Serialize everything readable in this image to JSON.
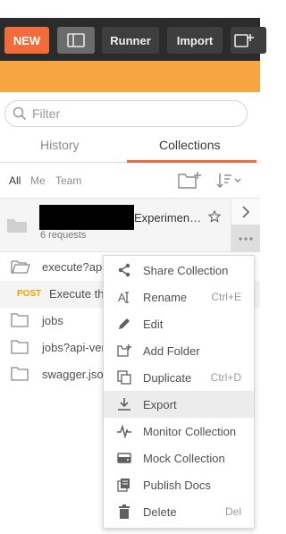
{
  "toolbar": {
    "new_label": "NEW",
    "runner_label": "Runner",
    "import_label": "Import"
  },
  "search": {
    "placeholder": "Filter"
  },
  "tabs": {
    "history": "History",
    "collections": "Collections"
  },
  "filters": {
    "all": "All",
    "me": "Me",
    "team": "Team"
  },
  "collection": {
    "name_visible": "Experimen…",
    "requests": "6 requests"
  },
  "items": [
    {
      "label": "execute?api-"
    },
    {
      "method": "POST",
      "label": "Execute the"
    },
    {
      "label": "jobs"
    },
    {
      "label": "jobs?api-ver"
    },
    {
      "label": "swagger.json"
    }
  ],
  "menu": {
    "items": [
      {
        "label": "Share Collection",
        "shortcut": "",
        "icon": "share-icon"
      },
      {
        "label": "Rename",
        "shortcut": "Ctrl+E",
        "icon": "rename-icon"
      },
      {
        "label": "Edit",
        "shortcut": "",
        "icon": "edit-icon"
      },
      {
        "label": "Add Folder",
        "shortcut": "",
        "icon": "add-folder-icon"
      },
      {
        "label": "Duplicate",
        "shortcut": "Ctrl+D",
        "icon": "duplicate-icon"
      },
      {
        "label": "Export",
        "shortcut": "",
        "icon": "export-icon",
        "highlighted": true
      },
      {
        "label": "Monitor Collection",
        "shortcut": "",
        "icon": "monitor-icon"
      },
      {
        "label": "Mock Collection",
        "shortcut": "",
        "icon": "mock-icon"
      },
      {
        "label": "Publish Docs",
        "shortcut": "",
        "icon": "publish-docs-icon"
      },
      {
        "label": "Delete",
        "shortcut": "Del",
        "icon": "delete-icon"
      }
    ]
  },
  "colors": {
    "accent": "#f26b3a",
    "topbar": "#2b2b2b",
    "banner": "#f7a541",
    "post_method": "#f5a000"
  }
}
